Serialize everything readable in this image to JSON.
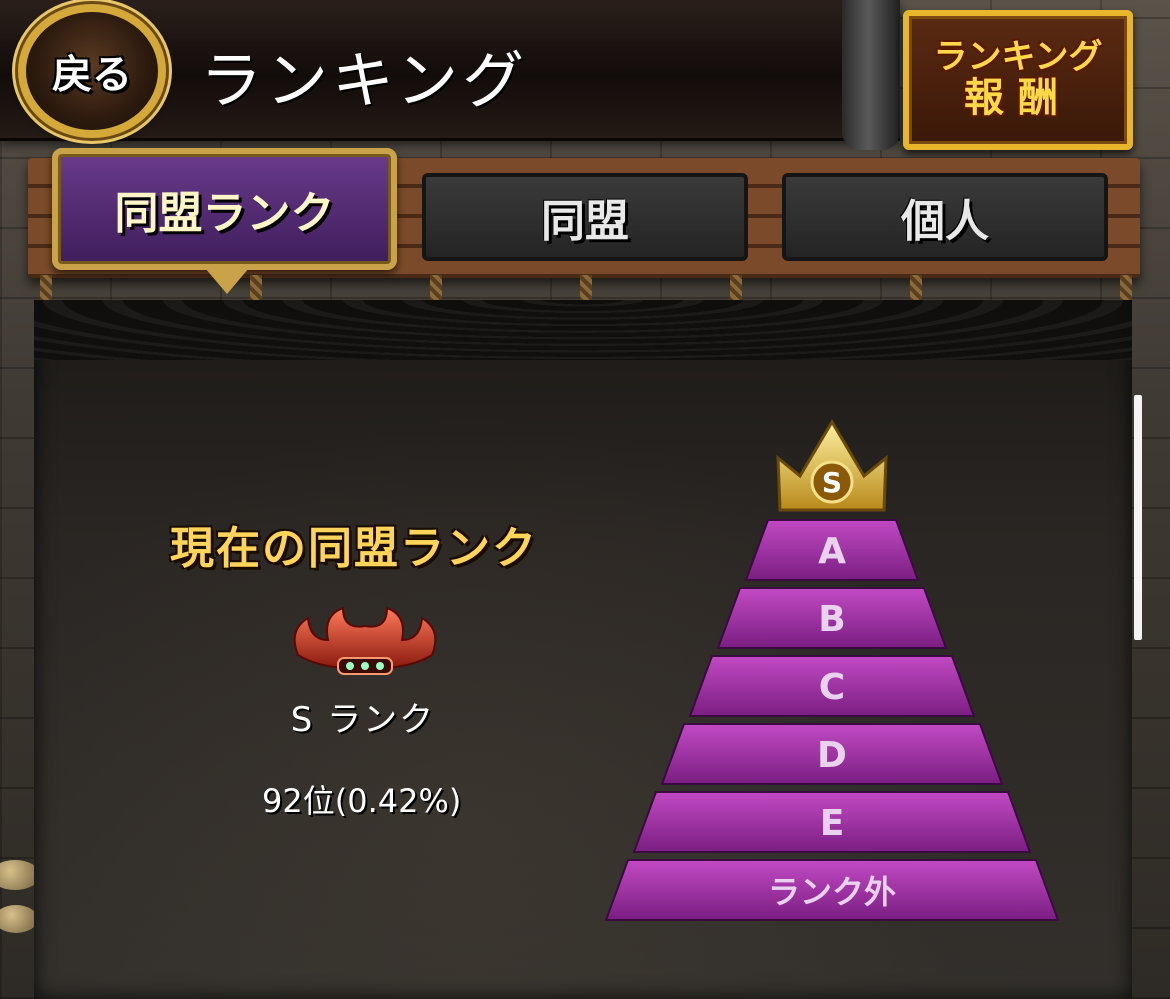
{
  "header": {
    "back_label": "戻る",
    "title": "ランキング",
    "reward_line1": "ランキング",
    "reward_line2": "報酬"
  },
  "tabs": [
    {
      "label": "同盟ランク",
      "active": true
    },
    {
      "label": "同盟",
      "active": false
    },
    {
      "label": "個人",
      "active": false
    }
  ],
  "current": {
    "heading": "現在の同盟ランク",
    "rank_name": "S ランク",
    "position": "92位(0.42%)"
  },
  "pyramid": {
    "top_badge": "S",
    "tiers": [
      "A",
      "B",
      "C",
      "D",
      "E",
      "ランク外"
    ]
  },
  "colors": {
    "gold": "#ffd45a",
    "tier_purple": "#a12fa8",
    "tab_active": "#4e2a70"
  }
}
